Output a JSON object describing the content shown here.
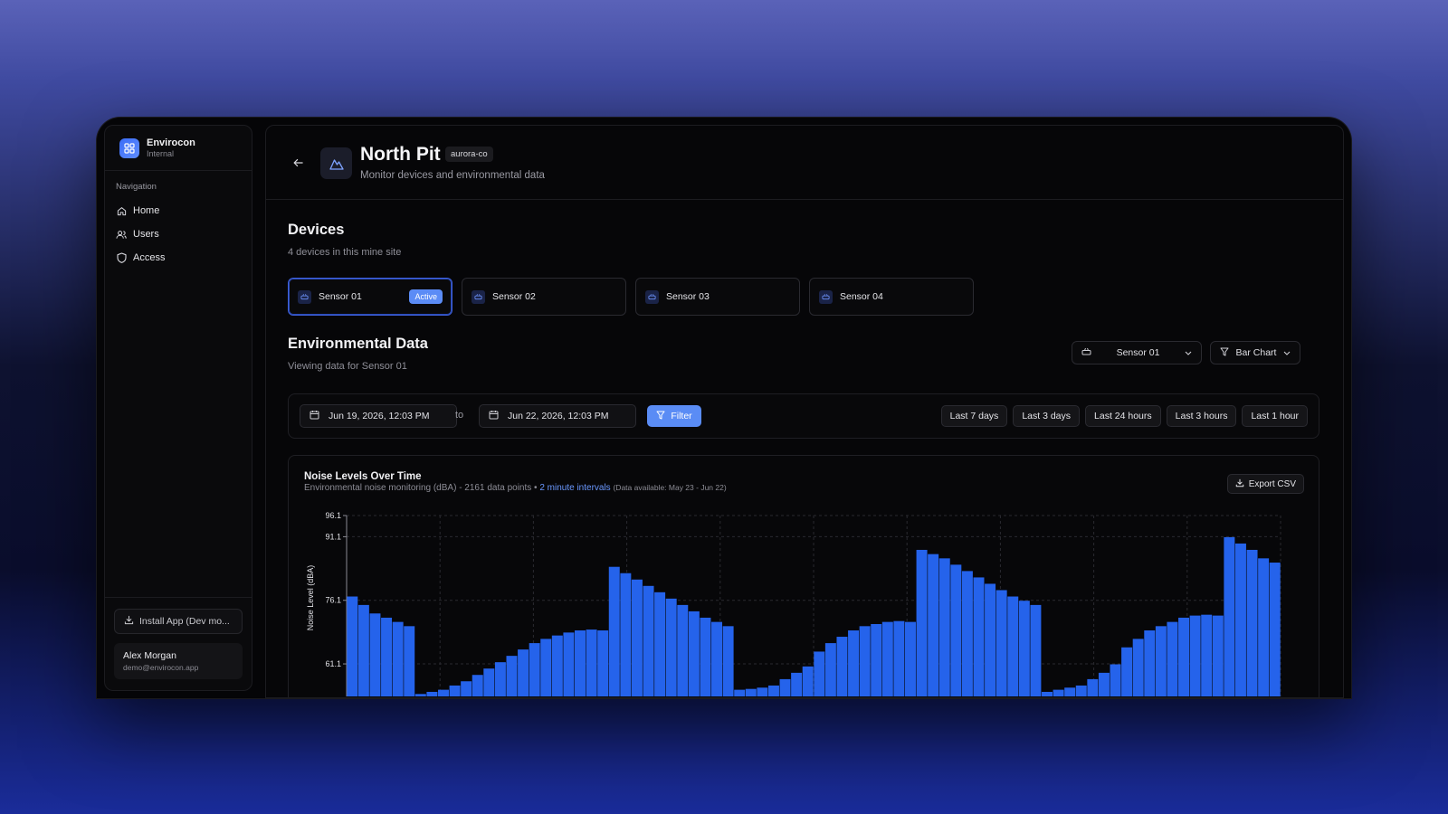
{
  "brand": {
    "name": "Envirocon",
    "subtitle": "Internal"
  },
  "sidebar": {
    "nav_label": "Navigation",
    "items": [
      {
        "label": "Home",
        "icon": "home-icon"
      },
      {
        "label": "Users",
        "icon": "users-icon"
      },
      {
        "label": "Access",
        "icon": "shield-icon"
      }
    ],
    "install_label": "Install App (Dev mo...",
    "user": {
      "name": "Alex Morgan",
      "email": "demo@envirocon.app"
    }
  },
  "header": {
    "title": "North Pit",
    "tag": "aurora-co",
    "subtitle": "Monitor devices and environmental data"
  },
  "devices_section": {
    "title": "Devices",
    "subtitle": "4 devices in this mine site",
    "devices": [
      {
        "label": "Sensor 01",
        "badge": "Active"
      },
      {
        "label": "Sensor 02"
      },
      {
        "label": "Sensor 03"
      },
      {
        "label": "Sensor 04"
      }
    ]
  },
  "env_section": {
    "title": "Environmental Data",
    "subtitle": "Viewing data for Sensor 01",
    "sensor_select": "Sensor 01",
    "chart_type_select": "Bar Chart"
  },
  "filter_bar": {
    "from": "Jun 19, 2026, 12:03 PM",
    "to_label": "to",
    "to": "Jun 22, 2026, 12:03 PM",
    "filter_label": "Filter",
    "ranges": [
      "Last 7 days",
      "Last 3 days",
      "Last 24 hours",
      "Last 3 hours",
      "Last 1 hour"
    ]
  },
  "chart_card": {
    "title": "Noise Levels Over Time",
    "subtitle_main": "Environmental noise monitoring (dBA) - 2161 data points • ",
    "subtitle_link": "2 minute intervals",
    "subtitle_small": "(Data available: May 23 - Jun 22)",
    "export_label": "Export CSV"
  },
  "colors": {
    "accent": "#5a8cf5",
    "bar": "#2563eb"
  },
  "chart_data": {
    "type": "bar",
    "ylabel": "Noise Level (dBA)",
    "xlabel": "",
    "title": "Noise Levels Over Time",
    "yticks": [
      61.1,
      76.1,
      91.1,
      96.1
    ],
    "ylim": [
      53,
      96.1
    ],
    "grid": true,
    "series": [
      {
        "values": [
          77,
          75,
          73,
          72,
          71,
          70,
          54,
          54.5,
          55,
          56,
          57,
          58.5,
          60,
          61.5,
          63,
          64.5,
          66,
          67,
          67.8,
          68.5,
          69,
          69.2,
          69,
          84,
          82.5,
          81,
          79.5,
          78,
          76.5,
          75,
          73.5,
          72,
          71,
          70,
          55,
          55.2,
          55.5,
          56,
          57.5,
          59,
          60.5,
          64,
          66,
          67.5,
          69,
          70,
          70.5,
          71,
          71.2,
          71,
          88,
          87,
          86,
          84.5,
          83,
          81.5,
          80,
          78.5,
          77,
          76,
          75,
          54.5,
          55,
          55.5,
          56,
          57.5,
          59,
          61,
          65,
          67,
          69,
          70,
          71,
          72,
          72.5,
          72.7,
          72.5,
          91,
          89.5,
          88,
          86,
          85
        ]
      }
    ]
  }
}
